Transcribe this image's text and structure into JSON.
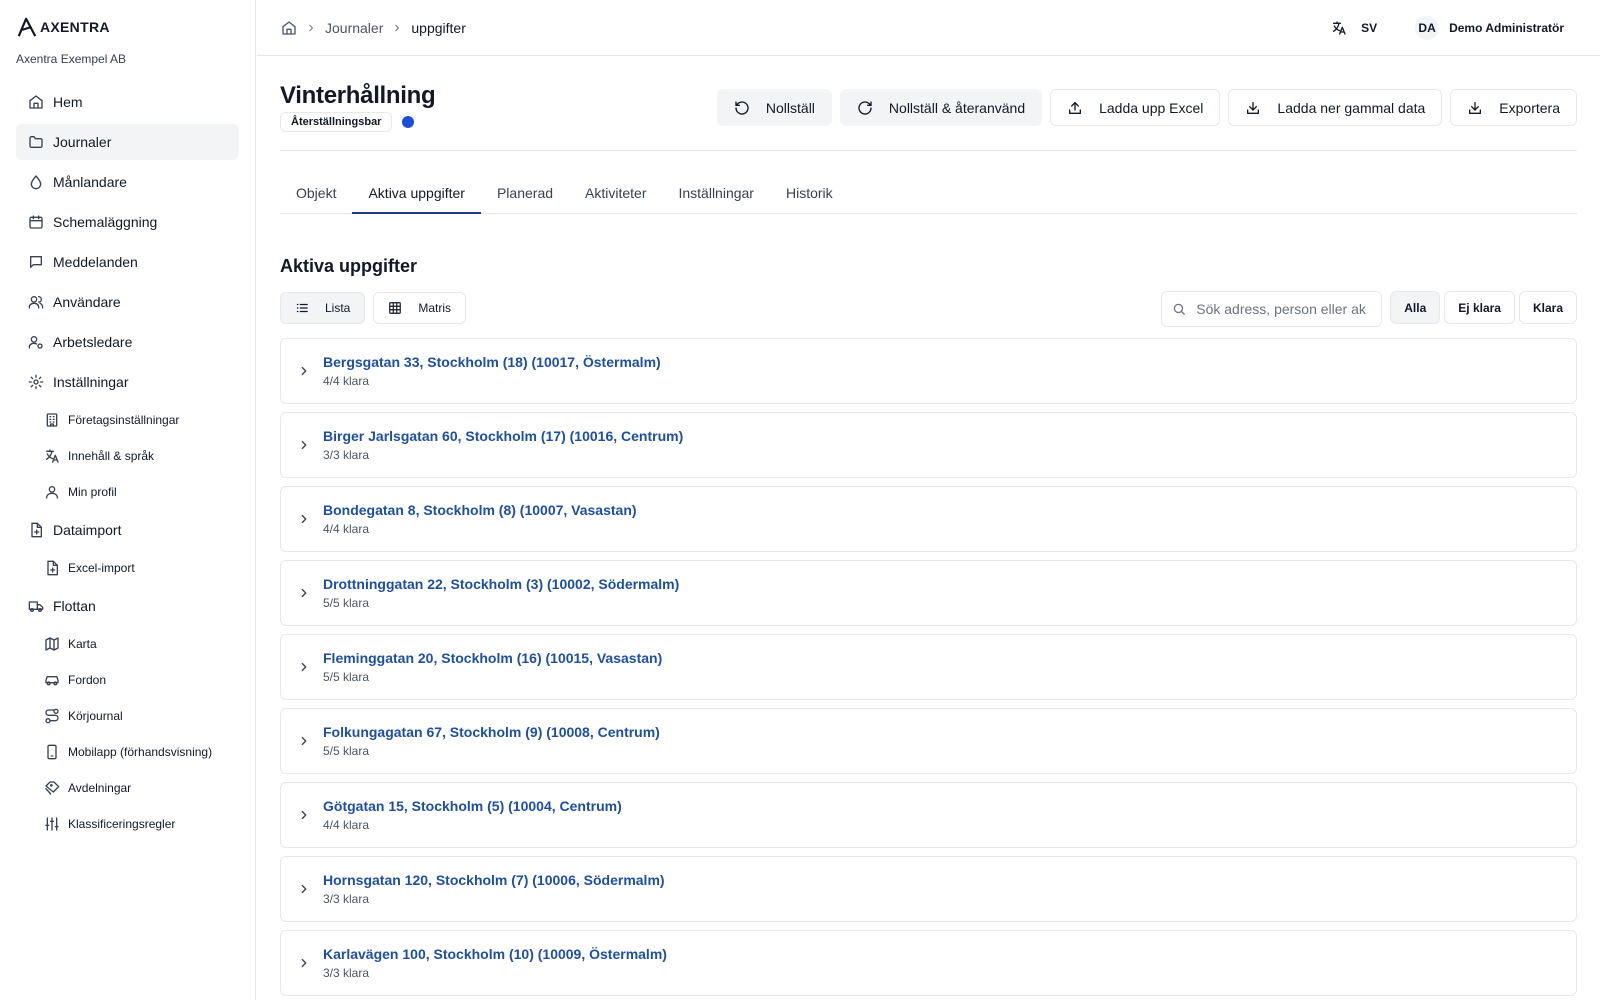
{
  "brand": {
    "logo_text": "AXENTRA",
    "company": "Axentra Exempel AB"
  },
  "sidebar": {
    "items": [
      {
        "label": "Hem",
        "icon": "home-icon",
        "level": 1,
        "active": false
      },
      {
        "label": "Journaler",
        "icon": "folder-icon",
        "level": 1,
        "active": true
      },
      {
        "label": "Månlandare",
        "icon": "drop-icon",
        "level": 1,
        "active": false
      },
      {
        "label": "Schemaläggning",
        "icon": "calendar-icon",
        "level": 1,
        "active": false
      },
      {
        "label": "Meddelanden",
        "icon": "message-icon",
        "level": 1,
        "active": false
      },
      {
        "label": "Användare",
        "icon": "users-icon",
        "level": 1,
        "active": false
      },
      {
        "label": "Arbetsledare",
        "icon": "user-cog-icon",
        "level": 1,
        "active": false
      },
      {
        "label": "Inställningar",
        "icon": "gear-icon",
        "level": 1,
        "active": false
      },
      {
        "label": "Företagsinställningar",
        "icon": "building-icon",
        "level": 2,
        "active": false
      },
      {
        "label": "Innehåll & språk",
        "icon": "translate-icon",
        "level": 2,
        "active": false
      },
      {
        "label": "Min profil",
        "icon": "user-icon",
        "level": 2,
        "active": false
      },
      {
        "label": "Dataimport",
        "icon": "file-plus-icon",
        "level": 1,
        "active": false
      },
      {
        "label": "Excel-import",
        "icon": "file-plus-icon",
        "level": 2,
        "active": false
      },
      {
        "label": "Flottan",
        "icon": "truck-icon",
        "level": 1,
        "active": false
      },
      {
        "label": "Karta",
        "icon": "map-icon",
        "level": 2,
        "active": false
      },
      {
        "label": "Fordon",
        "icon": "car-icon",
        "level": 2,
        "active": false
      },
      {
        "label": "Körjournal",
        "icon": "route-icon",
        "level": 2,
        "active": false
      },
      {
        "label": "Mobilapp (förhandsvisning)",
        "icon": "smartphone-icon",
        "level": 2,
        "active": false
      },
      {
        "label": "Avdelningar",
        "icon": "tags-icon",
        "level": 2,
        "active": false
      },
      {
        "label": "Klassificeringsregler",
        "icon": "sliders-icon",
        "level": 2,
        "active": false
      }
    ]
  },
  "header": {
    "breadcrumb": [
      "Journaler",
      "uppgifter"
    ],
    "language": "SV",
    "user_initials": "DA",
    "user_name": "Demo Administratör"
  },
  "page": {
    "title": "Vinterhållning",
    "badge": "Återställningsbar",
    "status_color": "#1d4ed8",
    "actions": [
      {
        "label": "Nollställ",
        "icon": "rotate-ccw-icon",
        "style": "grey"
      },
      {
        "label": "Nollställ & återanvänd",
        "icon": "rotate-cw-icon",
        "style": "grey"
      },
      {
        "label": "Ladda upp Excel",
        "icon": "upload-icon",
        "style": "outline"
      },
      {
        "label": "Ladda ner gammal data",
        "icon": "download-icon",
        "style": "outline"
      },
      {
        "label": "Exportera",
        "icon": "download-icon",
        "style": "outline"
      }
    ],
    "tabs": [
      {
        "label": "Objekt",
        "active": false
      },
      {
        "label": "Aktiva uppgifter",
        "active": true
      },
      {
        "label": "Planerad",
        "active": false
      },
      {
        "label": "Aktiviteter",
        "active": false
      },
      {
        "label": "Inställningar",
        "active": false
      },
      {
        "label": "Historik",
        "active": false
      }
    ],
    "section_title": "Aktiva uppgifter",
    "views": [
      {
        "label": "Lista",
        "icon": "list-icon",
        "active": true
      },
      {
        "label": "Matris",
        "icon": "grid-icon",
        "active": false
      }
    ],
    "search_placeholder": "Sök adress, person eller ak",
    "filters": [
      {
        "label": "Alla",
        "active": true
      },
      {
        "label": "Ej klara",
        "active": false
      },
      {
        "label": "Klara",
        "active": false
      }
    ],
    "rows": [
      {
        "title": "Bergsgatan 33, Stockholm (18) (10017, Östermalm)",
        "status": "4/4 klara"
      },
      {
        "title": "Birger Jarlsgatan 60, Stockholm (17) (10016, Centrum)",
        "status": "3/3 klara"
      },
      {
        "title": "Bondegatan 8, Stockholm (8) (10007, Vasastan)",
        "status": "4/4 klara"
      },
      {
        "title": "Drottninggatan 22, Stockholm (3) (10002, Södermalm)",
        "status": "5/5 klara"
      },
      {
        "title": "Fleminggatan 20, Stockholm (16) (10015, Vasastan)",
        "status": "5/5 klara"
      },
      {
        "title": "Folkungagatan 67, Stockholm (9) (10008, Centrum)",
        "status": "5/5 klara"
      },
      {
        "title": "Götgatan 15, Stockholm (5) (10004, Centrum)",
        "status": "4/4 klara"
      },
      {
        "title": "Hornsgatan 120, Stockholm (7) (10006, Södermalm)",
        "status": "3/3 klara"
      },
      {
        "title": "Karlavägen 100, Stockholm (10) (10009, Östermalm)",
        "status": "3/3 klara"
      }
    ]
  }
}
